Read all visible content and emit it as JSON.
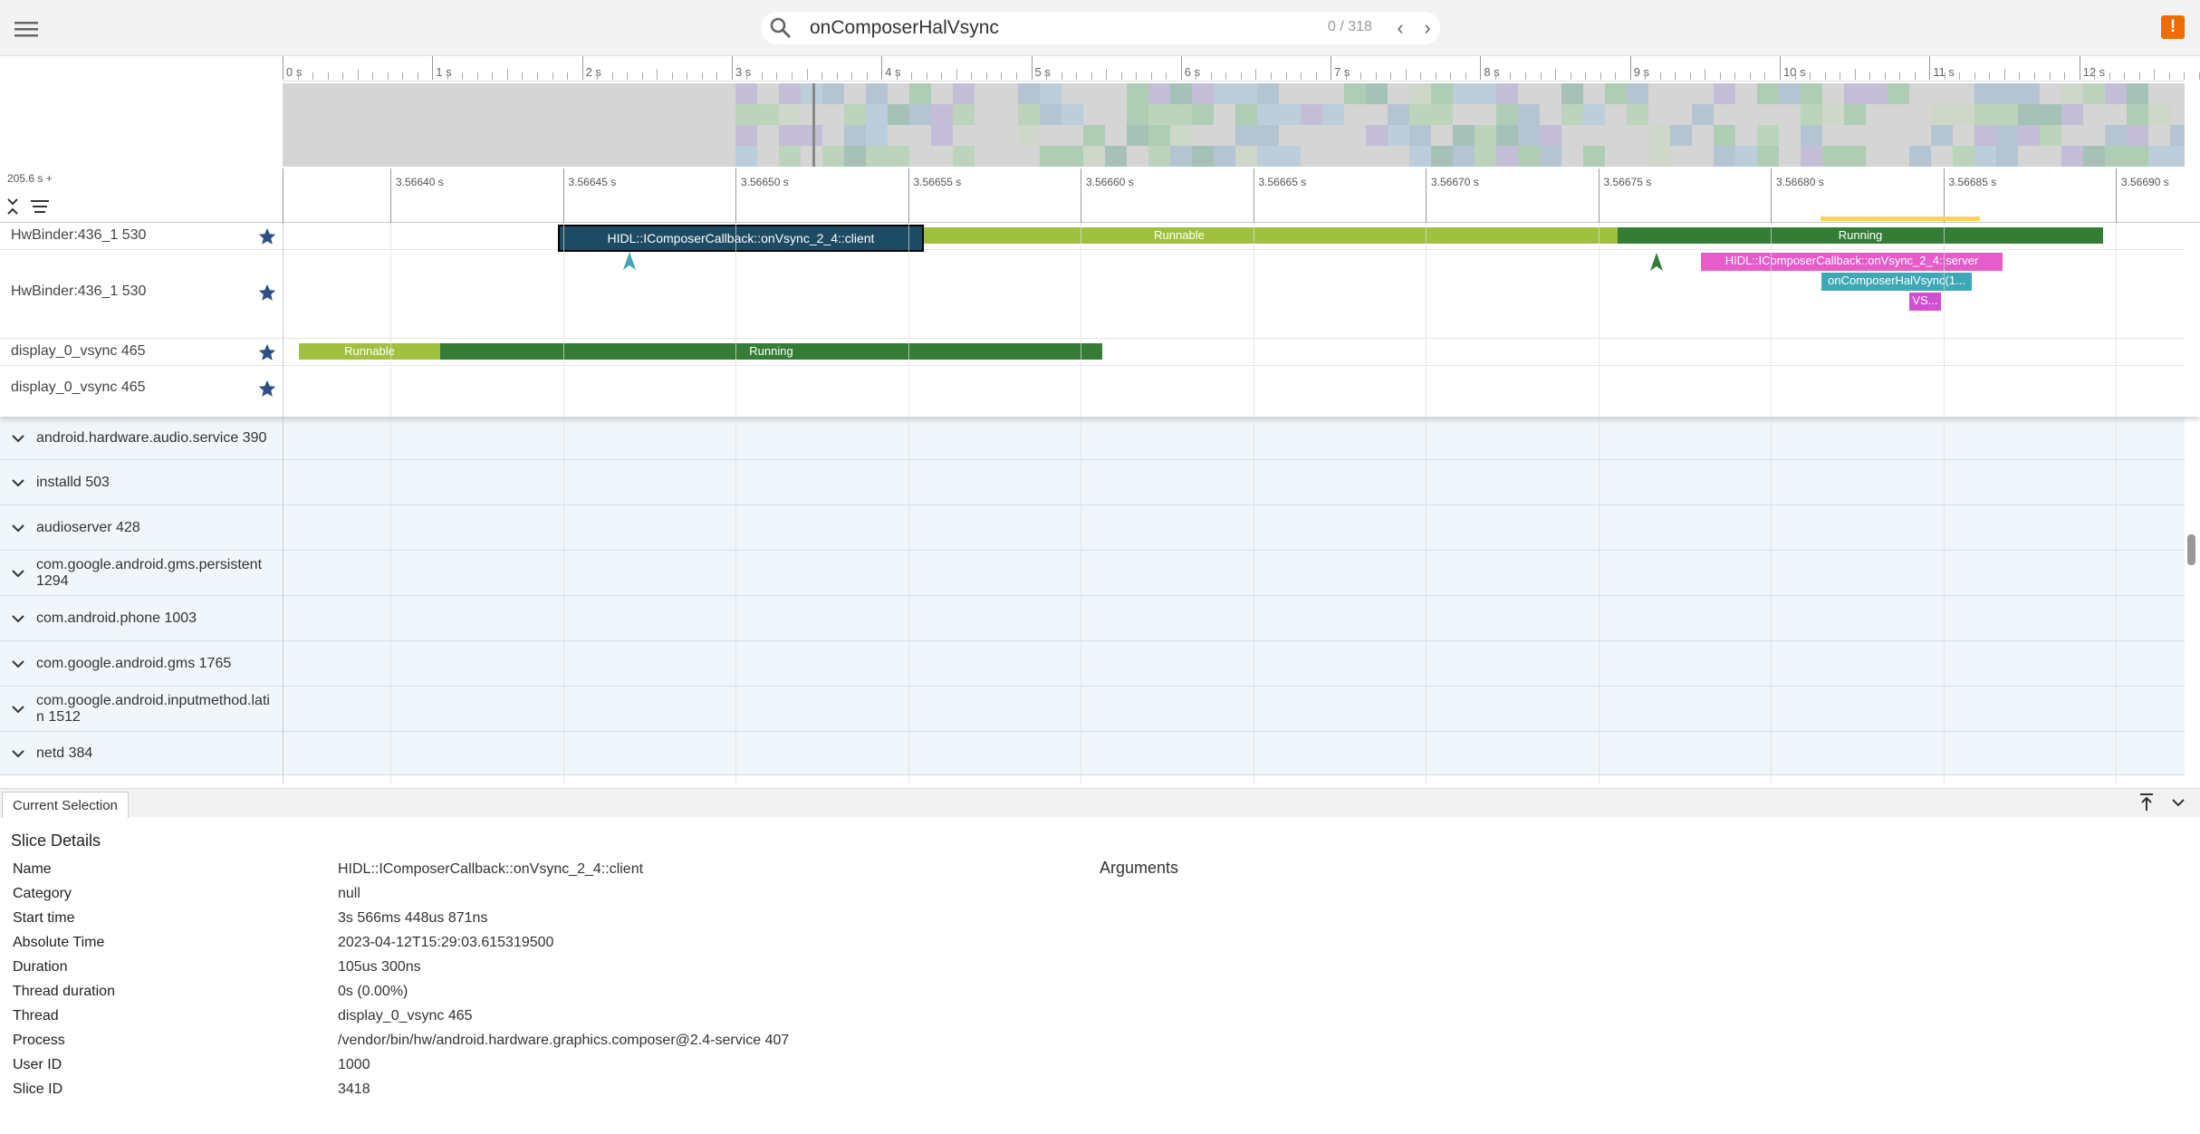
{
  "search": {
    "query": "onComposerHalVsync",
    "count": "0 / 318"
  },
  "ruler": {
    "ticks": [
      "0 s",
      "1 s",
      "2 s",
      "3 s",
      "4 s",
      "5 s",
      "6 s",
      "7 s",
      "8 s",
      "9 s",
      "10 s",
      "11 s",
      "12 s"
    ]
  },
  "selection": {
    "offset_label": "205.6 s +",
    "ticks": [
      "3.56640 s",
      "3.56645 s",
      "3.56650 s",
      "3.56655 s",
      "3.56660 s",
      "3.56665 s",
      "3.56670 s",
      "3.56675 s",
      "3.56680 s",
      "3.56685 s",
      "3.56690 s"
    ]
  },
  "pinned": [
    {
      "name": "HwBinder:436_1 530",
      "states": [
        {
          "label": "Runnable"
        },
        {
          "label": "Running"
        }
      ]
    },
    {
      "name": "HwBinder:436_1 530",
      "slices": [
        {
          "label": "HIDL::IComposerCallback::onVsync_2_4::server"
        },
        {
          "label": "onComposerHalVsync(1..."
        },
        {
          "label": "VS..."
        }
      ]
    },
    {
      "name": "display_0_vsync 465",
      "states": [
        {
          "label": "Runnable"
        },
        {
          "label": "Running"
        }
      ]
    },
    {
      "name": "display_0_vsync 465",
      "slices": [
        {
          "label": "HIDL::IComposerCallback::onVsync_2_4::client"
        }
      ]
    }
  ],
  "groups": [
    {
      "name": "android.hardware.audio.service 390"
    },
    {
      "name": "installd 503"
    },
    {
      "name": "audioserver 428"
    },
    {
      "name": "com.google.android.gms.persistent 1294",
      "line1": "com.google.android.gms.persistent",
      "line2": "1294"
    },
    {
      "name": "com.android.phone 1003"
    },
    {
      "name": "com.google.android.gms 1765"
    },
    {
      "name": "com.google.android.inputmethod.latin 1512",
      "line1": "com.google.android.inputmethod.lati",
      "line2": "n 1512"
    },
    {
      "name": "netd 384"
    }
  ],
  "details": {
    "tab": "Current Selection",
    "title": "Slice Details",
    "args_title": "Arguments",
    "rows": [
      {
        "label": "Name",
        "value": "HIDL::IComposerCallback::onVsync_2_4::client"
      },
      {
        "label": "Category",
        "value": "null"
      },
      {
        "label": "Start time",
        "value": "3s 566ms 448us 871ns"
      },
      {
        "label": "Absolute Time",
        "value": "2023-04-12T15:29:03.615319500"
      },
      {
        "label": "Duration",
        "value": "105us 300ns"
      },
      {
        "label": "Thread duration",
        "value": "0s (0.00%)"
      },
      {
        "label": "Thread",
        "value": "display_0_vsync 465"
      },
      {
        "label": "Process",
        "value": "/vendor/bin/hw/android.hardware.graphics.composer@2.4-service 407"
      },
      {
        "label": "User ID",
        "value": "1000"
      },
      {
        "label": "Slice ID",
        "value": "3418"
      }
    ]
  },
  "colors": {
    "runnable": "#a0c13f",
    "running": "#357d37",
    "server": "#e65cc8",
    "halvsync": "#3fa8b5",
    "client": "#1d4b63",
    "star": "#2f4f86"
  }
}
